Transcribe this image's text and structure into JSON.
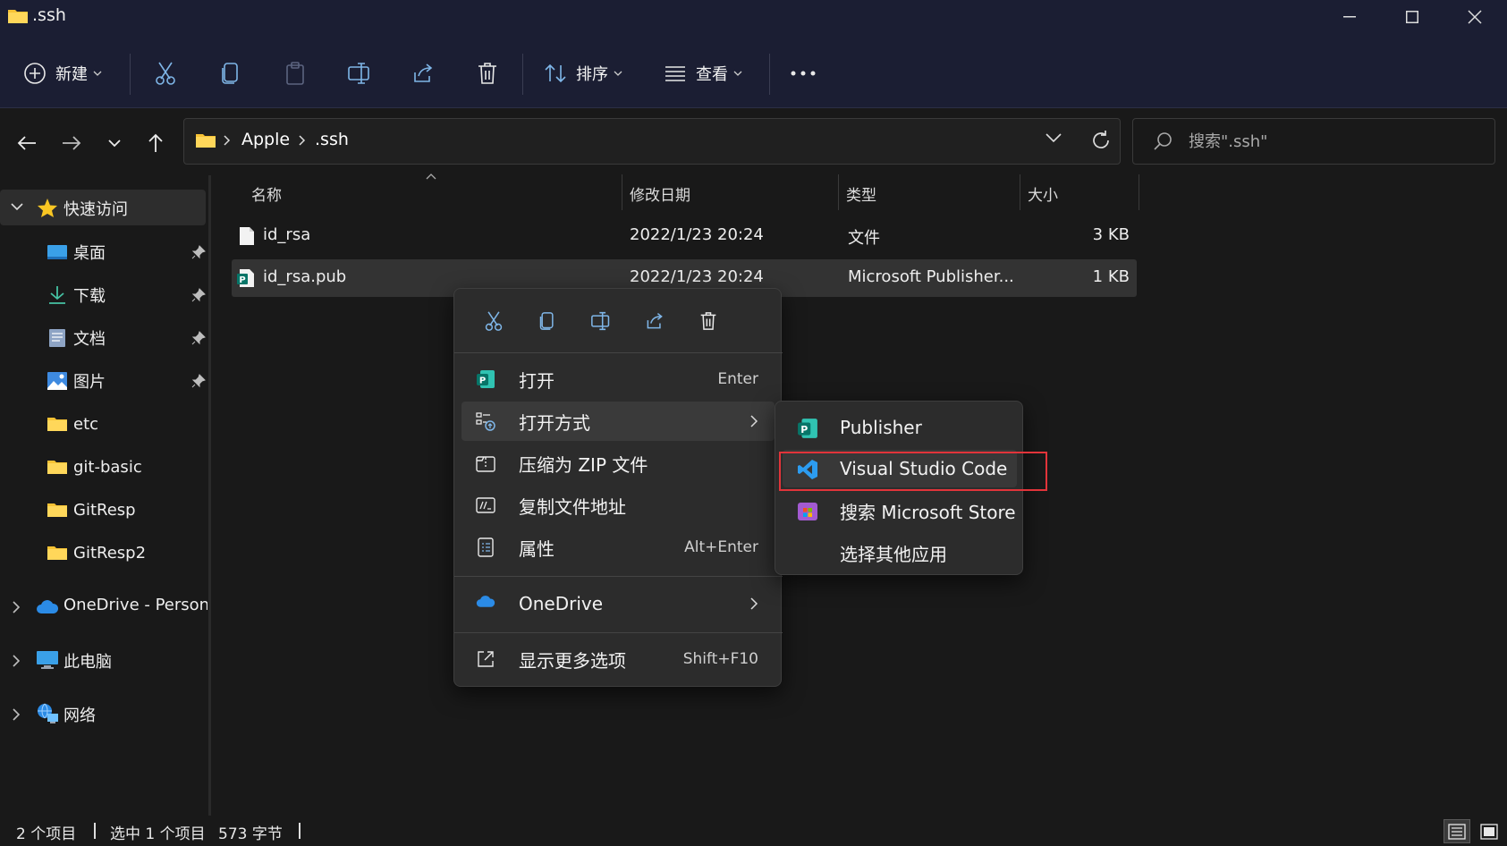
{
  "window": {
    "title": ".ssh",
    "minimize_icon": "minimize-icon",
    "maximize_icon": "maximize-icon",
    "close_icon": "close-icon"
  },
  "toolbar": {
    "new_label": "新建",
    "sort_label": "排序",
    "view_label": "查看",
    "icons": [
      "cut-icon",
      "copy-icon",
      "paste-icon",
      "rename-icon",
      "share-icon",
      "delete-icon",
      "more-icon"
    ]
  },
  "address": {
    "crumbs": [
      "Apple",
      ".ssh"
    ]
  },
  "search": {
    "placeholder": "搜索\".ssh\""
  },
  "sidebar": {
    "quick_access": "快速访问",
    "items": [
      {
        "label": "桌面",
        "pinned": true
      },
      {
        "label": "下载",
        "pinned": true
      },
      {
        "label": "文档",
        "pinned": true
      },
      {
        "label": "图片",
        "pinned": true
      },
      {
        "label": "etc",
        "pinned": false
      },
      {
        "label": "git-basic",
        "pinned": false
      },
      {
        "label": "GitResp",
        "pinned": false
      },
      {
        "label": "GitResp2",
        "pinned": false
      }
    ],
    "onedrive": "OneDrive - Persona",
    "this_pc": "此电脑",
    "network": "网络"
  },
  "filelist": {
    "columns": [
      "名称",
      "修改日期",
      "类型",
      "大小"
    ],
    "rows": [
      {
        "name": "id_rsa",
        "date": "2022/1/23 20:24",
        "type": "文件",
        "size": "3 KB"
      },
      {
        "name": "id_rsa.pub",
        "date": "2022/1/23 20:24",
        "type": "Microsoft Publisher...",
        "size": "1 KB"
      }
    ]
  },
  "context_menu": {
    "items": [
      {
        "label": "打开",
        "shortcut": "Enter"
      },
      {
        "label": "打开方式",
        "shortcut": ""
      },
      {
        "label": "压缩为 ZIP 文件",
        "shortcut": ""
      },
      {
        "label": "复制文件地址",
        "shortcut": ""
      },
      {
        "label": "属性",
        "shortcut": "Alt+Enter"
      }
    ],
    "onedrive": "OneDrive",
    "more_options": {
      "label": "显示更多选项",
      "shortcut": "Shift+F10"
    }
  },
  "submenu": {
    "items": [
      "Publisher",
      "Visual Studio Code",
      "搜索 Microsoft Store",
      "选择其他应用"
    ]
  },
  "statusbar": {
    "count": "2 个项目",
    "selected": "选中 1 个项目",
    "size": "573 字节"
  },
  "colors": {
    "titlebar": "#1b1e33",
    "background": "#191919",
    "menu": "#2c2c2c",
    "highlight": "#e2343a",
    "folder": "#f7c234"
  }
}
